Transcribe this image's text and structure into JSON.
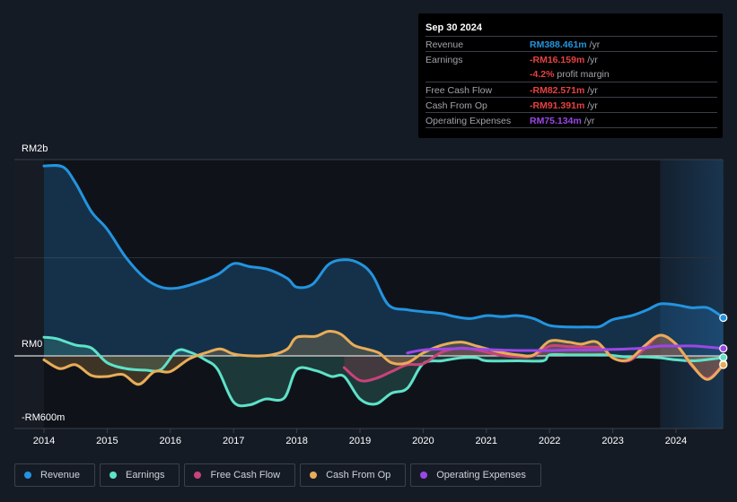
{
  "chart_data": {
    "type": "area",
    "title": "",
    "xlabel": "",
    "ylabel": "",
    "y_unit": "RM m",
    "ylim": [
      -740,
      2000
    ],
    "xlim": [
      2013.55,
      2024.75
    ],
    "y_tick_labels": [
      {
        "value": 2000,
        "label": "RM2b"
      },
      {
        "value": 0,
        "label": "RM0"
      },
      {
        "value": -600,
        "label": "-RM600m"
      }
    ],
    "x_ticks": [
      2014,
      2015,
      2016,
      2017,
      2018,
      2019,
      2020,
      2021,
      2022,
      2023,
      2024
    ],
    "x_tick_labels": [
      "2014",
      "2015",
      "2016",
      "2017",
      "2018",
      "2019",
      "2020",
      "2021",
      "2022",
      "2023",
      "2024"
    ],
    "highlight_range": [
      2023.75,
      2024.75
    ],
    "grid": true,
    "legend_position": "bottom",
    "series": [
      {
        "name": "Revenue",
        "color": "#2394df",
        "fill": true,
        "points": [
          [
            2014.0,
            1935
          ],
          [
            2014.3,
            1925
          ],
          [
            2014.5,
            1760
          ],
          [
            2014.75,
            1470
          ],
          [
            2015.0,
            1290
          ],
          [
            2015.3,
            1000
          ],
          [
            2015.6,
            790
          ],
          [
            2015.85,
            700
          ],
          [
            2016.1,
            690
          ],
          [
            2016.4,
            740
          ],
          [
            2016.75,
            830
          ],
          [
            2017.0,
            940
          ],
          [
            2017.25,
            910
          ],
          [
            2017.55,
            880
          ],
          [
            2017.85,
            790
          ],
          [
            2018.0,
            700
          ],
          [
            2018.25,
            730
          ],
          [
            2018.5,
            930
          ],
          [
            2018.75,
            980
          ],
          [
            2019.0,
            940
          ],
          [
            2019.2,
            820
          ],
          [
            2019.45,
            520
          ],
          [
            2019.75,
            470
          ],
          [
            2020.0,
            450
          ],
          [
            2020.3,
            430
          ],
          [
            2020.5,
            400
          ],
          [
            2020.75,
            380
          ],
          [
            2021.0,
            410
          ],
          [
            2021.25,
            400
          ],
          [
            2021.5,
            410
          ],
          [
            2021.75,
            380
          ],
          [
            2022.0,
            310
          ],
          [
            2022.3,
            295
          ],
          [
            2022.6,
            295
          ],
          [
            2022.8,
            300
          ],
          [
            2023.0,
            370
          ],
          [
            2023.3,
            410
          ],
          [
            2023.55,
            470
          ],
          [
            2023.75,
            530
          ],
          [
            2024.0,
            520
          ],
          [
            2024.25,
            490
          ],
          [
            2024.5,
            490
          ],
          [
            2024.75,
            388.461
          ]
        ]
      },
      {
        "name": "Earnings",
        "color": "#5ee2c9",
        "fill": true,
        "points": [
          [
            2014.0,
            190
          ],
          [
            2014.2,
            175
          ],
          [
            2014.5,
            110
          ],
          [
            2014.75,
            80
          ],
          [
            2015.0,
            -70
          ],
          [
            2015.3,
            -130
          ],
          [
            2015.6,
            -145
          ],
          [
            2015.85,
            -140
          ],
          [
            2016.1,
            50
          ],
          [
            2016.3,
            40
          ],
          [
            2016.55,
            -40
          ],
          [
            2016.75,
            -140
          ],
          [
            2017.0,
            -470
          ],
          [
            2017.25,
            -500
          ],
          [
            2017.5,
            -440
          ],
          [
            2017.8,
            -430
          ],
          [
            2018.0,
            -140
          ],
          [
            2018.3,
            -150
          ],
          [
            2018.55,
            -210
          ],
          [
            2018.75,
            -210
          ],
          [
            2019.0,
            -440
          ],
          [
            2019.25,
            -490
          ],
          [
            2019.5,
            -380
          ],
          [
            2019.75,
            -330
          ],
          [
            2020.0,
            -80
          ],
          [
            2020.3,
            -50
          ],
          [
            2020.6,
            -20
          ],
          [
            2020.85,
            -20
          ],
          [
            2021.0,
            -50
          ],
          [
            2021.5,
            -50
          ],
          [
            2021.9,
            -50
          ],
          [
            2022.0,
            10
          ],
          [
            2022.3,
            10
          ],
          [
            2022.6,
            10
          ],
          [
            2022.9,
            10
          ],
          [
            2023.2,
            -10
          ],
          [
            2023.5,
            -10
          ],
          [
            2023.75,
            -20
          ],
          [
            2024.0,
            -40
          ],
          [
            2024.3,
            -50
          ],
          [
            2024.75,
            -16.159
          ]
        ]
      },
      {
        "name": "Free Cash Flow",
        "color": "#c9437a",
        "fill": true,
        "points": [
          [
            2018.75,
            -120
          ],
          [
            2019.0,
            -250
          ],
          [
            2019.25,
            -230
          ],
          [
            2019.5,
            -160
          ],
          [
            2019.75,
            -90
          ],
          [
            2020.0,
            -80
          ],
          [
            2020.3,
            40
          ],
          [
            2020.6,
            80
          ],
          [
            2020.85,
            60
          ],
          [
            2021.2,
            10
          ],
          [
            2021.5,
            -10
          ],
          [
            2021.75,
            0
          ],
          [
            2022.0,
            100
          ],
          [
            2022.3,
            95
          ],
          [
            2022.6,
            90
          ],
          [
            2022.85,
            80
          ],
          [
            2023.0,
            -20
          ],
          [
            2023.25,
            -50
          ],
          [
            2023.5,
            70
          ],
          [
            2023.75,
            210
          ],
          [
            2024.0,
            120
          ],
          [
            2024.25,
            -100
          ],
          [
            2024.5,
            -230
          ],
          [
            2024.75,
            -82.571
          ]
        ]
      },
      {
        "name": "Cash From Op",
        "color": "#e8ad58",
        "fill": true,
        "points": [
          [
            2014.0,
            -40
          ],
          [
            2014.25,
            -130
          ],
          [
            2014.5,
            -90
          ],
          [
            2014.75,
            -200
          ],
          [
            2015.0,
            -210
          ],
          [
            2015.25,
            -190
          ],
          [
            2015.5,
            -290
          ],
          [
            2015.75,
            -160
          ],
          [
            2016.0,
            -160
          ],
          [
            2016.3,
            -30
          ],
          [
            2016.6,
            40
          ],
          [
            2016.8,
            70
          ],
          [
            2017.0,
            20
          ],
          [
            2017.3,
            0
          ],
          [
            2017.6,
            10
          ],
          [
            2017.85,
            70
          ],
          [
            2018.0,
            190
          ],
          [
            2018.3,
            200
          ],
          [
            2018.5,
            250
          ],
          [
            2018.7,
            220
          ],
          [
            2018.9,
            110
          ],
          [
            2019.1,
            70
          ],
          [
            2019.3,
            30
          ],
          [
            2019.5,
            -70
          ],
          [
            2019.75,
            -70
          ],
          [
            2020.0,
            30
          ],
          [
            2020.3,
            110
          ],
          [
            2020.6,
            140
          ],
          [
            2020.85,
            100
          ],
          [
            2021.2,
            40
          ],
          [
            2021.5,
            10
          ],
          [
            2021.75,
            10
          ],
          [
            2022.0,
            150
          ],
          [
            2022.3,
            140
          ],
          [
            2022.5,
            120
          ],
          [
            2022.75,
            140
          ],
          [
            2023.0,
            -20
          ],
          [
            2023.25,
            -40
          ],
          [
            2023.5,
            100
          ],
          [
            2023.75,
            210
          ],
          [
            2024.0,
            120
          ],
          [
            2024.25,
            -90
          ],
          [
            2024.5,
            -240
          ],
          [
            2024.75,
            -91.391
          ]
        ]
      },
      {
        "name": "Operating Expenses",
        "color": "#9b47e6",
        "fill": false,
        "points": [
          [
            2019.75,
            30
          ],
          [
            2020.0,
            60
          ],
          [
            2020.3,
            70
          ],
          [
            2020.6,
            75
          ],
          [
            2020.85,
            70
          ],
          [
            2021.2,
            60
          ],
          [
            2021.5,
            55
          ],
          [
            2021.75,
            55
          ],
          [
            2022.0,
            55
          ],
          [
            2022.3,
            60
          ],
          [
            2022.6,
            60
          ],
          [
            2022.9,
            65
          ],
          [
            2023.2,
            70
          ],
          [
            2023.5,
            80
          ],
          [
            2023.75,
            100
          ],
          [
            2024.0,
            100
          ],
          [
            2024.3,
            100
          ],
          [
            2024.75,
            75.134
          ]
        ]
      }
    ]
  },
  "tooltip": {
    "date": "Sep 30 2024",
    "rows": [
      {
        "label": "Revenue",
        "value": "RM388.461m",
        "unit": " /yr",
        "color": "#2394df"
      },
      {
        "label": "Earnings",
        "value": "-RM16.159m",
        "unit": " /yr",
        "color": "#e84141"
      },
      {
        "label": "",
        "value": "-4.2%",
        "unit": " profit margin",
        "color": "#e84141"
      },
      {
        "label": "Free Cash Flow",
        "value": "-RM82.571m",
        "unit": " /yr",
        "color": "#e84141"
      },
      {
        "label": "Cash From Op",
        "value": "-RM91.391m",
        "unit": " /yr",
        "color": "#e84141"
      },
      {
        "label": "Operating Expenses",
        "value": "RM75.134m",
        "unit": " /yr",
        "color": "#9b47e6"
      }
    ]
  },
  "legend": [
    {
      "label": "Revenue",
      "color": "#2394df"
    },
    {
      "label": "Earnings",
      "color": "#5ee2c9"
    },
    {
      "label": "Free Cash Flow",
      "color": "#c9437a"
    },
    {
      "label": "Cash From Op",
      "color": "#e8ad58"
    },
    {
      "label": "Operating Expenses",
      "color": "#9b47e6"
    }
  ]
}
